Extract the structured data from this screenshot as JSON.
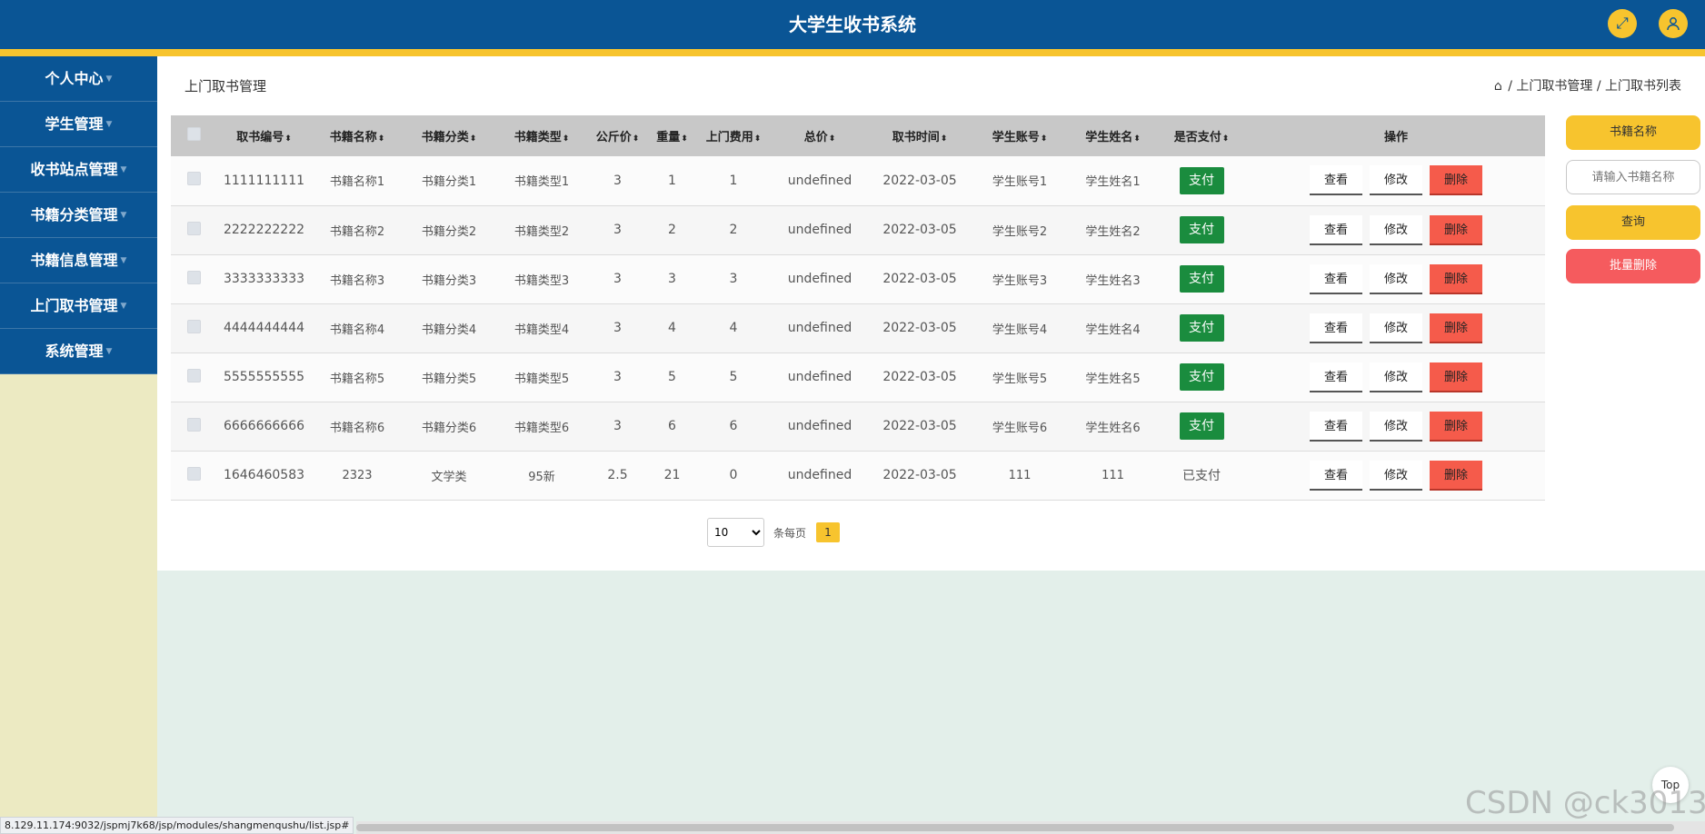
{
  "header": {
    "title": "大学生收书系统",
    "fullscreen_icon": "expand-icon",
    "user_icon": "user-icon"
  },
  "sidebar": {
    "items": [
      {
        "label": "个人中心"
      },
      {
        "label": "学生管理"
      },
      {
        "label": "收书站点管理"
      },
      {
        "label": "书籍分类管理"
      },
      {
        "label": "书籍信息管理"
      },
      {
        "label": "上门取书管理"
      },
      {
        "label": "系统管理"
      }
    ]
  },
  "main": {
    "page_title": "上门取书管理",
    "breadcrumb": [
      "上门取书管理",
      "上门取书列表"
    ],
    "table": {
      "columns": [
        "取书编号",
        "书籍名称",
        "书籍分类",
        "书籍类型",
        "公斤价",
        "重量",
        "上门费用",
        "总价",
        "取书时间",
        "学生账号",
        "学生姓名",
        "是否支付",
        "操作"
      ],
      "rows": [
        {
          "id": "1111111111",
          "name": "书籍名称1",
          "category": "书籍分类1",
          "type": "书籍类型1",
          "price": "3",
          "weight": "1",
          "fee": "1",
          "total": "undefined",
          "time": "2022-03-05",
          "account": "学生账号1",
          "student": "学生姓名1",
          "paid": "支付",
          "paid_is_button": true
        },
        {
          "id": "2222222222",
          "name": "书籍名称2",
          "category": "书籍分类2",
          "type": "书籍类型2",
          "price": "3",
          "weight": "2",
          "fee": "2",
          "total": "undefined",
          "time": "2022-03-05",
          "account": "学生账号2",
          "student": "学生姓名2",
          "paid": "支付",
          "paid_is_button": true
        },
        {
          "id": "3333333333",
          "name": "书籍名称3",
          "category": "书籍分类3",
          "type": "书籍类型3",
          "price": "3",
          "weight": "3",
          "fee": "3",
          "total": "undefined",
          "time": "2022-03-05",
          "account": "学生账号3",
          "student": "学生姓名3",
          "paid": "支付",
          "paid_is_button": true
        },
        {
          "id": "4444444444",
          "name": "书籍名称4",
          "category": "书籍分类4",
          "type": "书籍类型4",
          "price": "3",
          "weight": "4",
          "fee": "4",
          "total": "undefined",
          "time": "2022-03-05",
          "account": "学生账号4",
          "student": "学生姓名4",
          "paid": "支付",
          "paid_is_button": true
        },
        {
          "id": "5555555555",
          "name": "书籍名称5",
          "category": "书籍分类5",
          "type": "书籍类型5",
          "price": "3",
          "weight": "5",
          "fee": "5",
          "total": "undefined",
          "time": "2022-03-05",
          "account": "学生账号5",
          "student": "学生姓名5",
          "paid": "支付",
          "paid_is_button": true
        },
        {
          "id": "6666666666",
          "name": "书籍名称6",
          "category": "书籍分类6",
          "type": "书籍类型6",
          "price": "3",
          "weight": "6",
          "fee": "6",
          "total": "undefined",
          "time": "2022-03-05",
          "account": "学生账号6",
          "student": "学生姓名6",
          "paid": "支付",
          "paid_is_button": true
        },
        {
          "id": "1646460583",
          "name": "2323",
          "category": "文学类",
          "type": "95新",
          "price": "2.5",
          "weight": "21",
          "fee": "0",
          "total": "undefined",
          "time": "2022-03-05",
          "account": "111",
          "student": "111",
          "paid": "已支付",
          "paid_is_button": false
        }
      ],
      "actions": {
        "view": "查看",
        "edit": "修改",
        "delete": "删除"
      }
    },
    "pagination": {
      "page_size": "10",
      "page_size_options": [
        "10"
      ],
      "per_page_label": "条每页",
      "current_page": "1"
    }
  },
  "search": {
    "label": "书籍名称",
    "placeholder": "请输入书籍名称",
    "query_button": "查询",
    "batch_delete_button": "批量删除"
  },
  "top_button": "Top",
  "status_url": "8.129.11.174:9032/jspmj7k68/jsp/modules/shangmenqushu/list.jsp#",
  "watermark": "CSDN @ck3013",
  "colors": {
    "primary": "#0a5595",
    "accent": "#f7c42e",
    "pay": "#1a8c3e",
    "delete": "#f55b4b",
    "sidebar_bg": "#eceac2",
    "page_bg": "#e3efea"
  }
}
